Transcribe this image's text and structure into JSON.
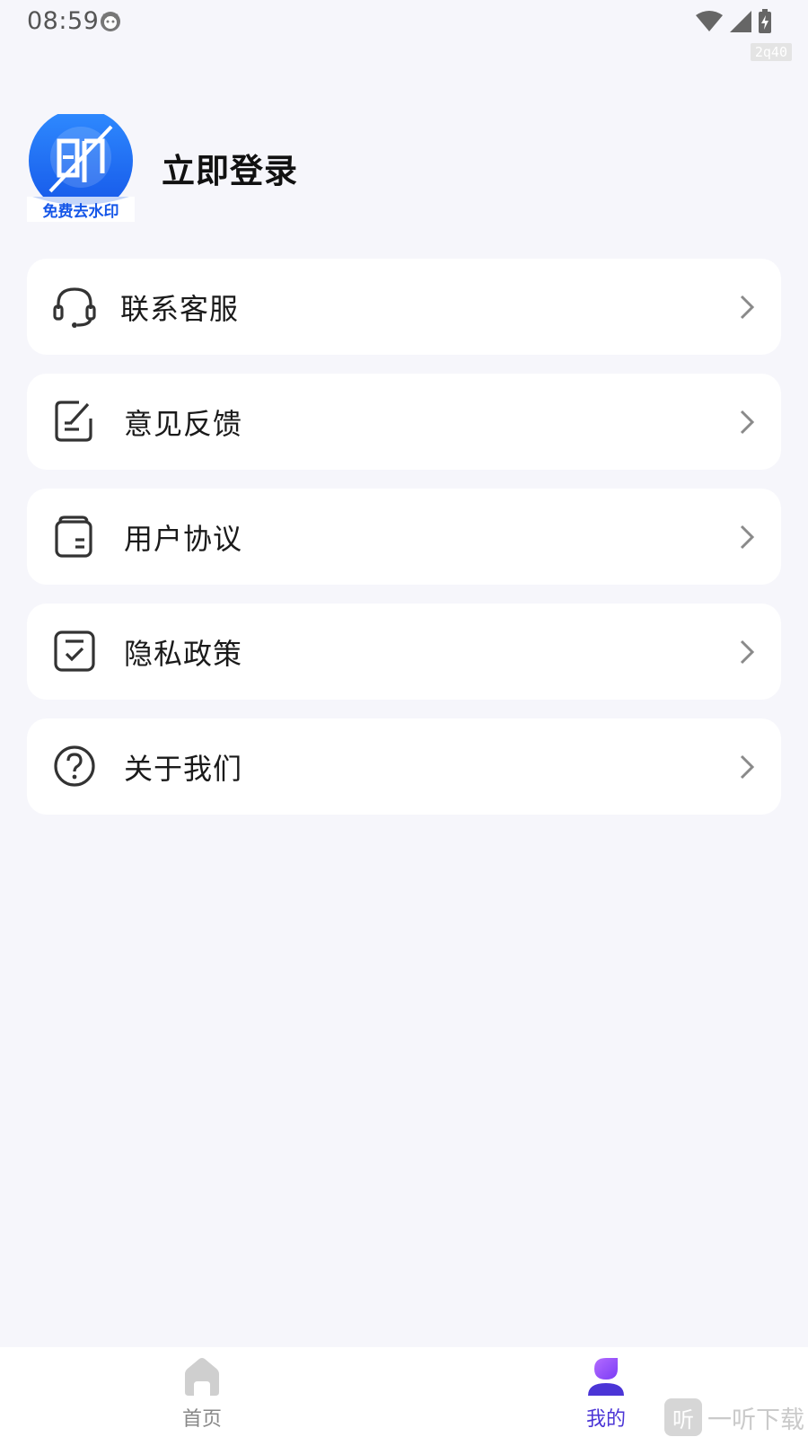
{
  "status_bar": {
    "time": "08:59",
    "debug_badge": "2q40"
  },
  "profile": {
    "avatar_caption": "免费去水印",
    "avatar_glyph": "印",
    "login_label": "立即登录"
  },
  "menu": {
    "items": [
      {
        "label": "联系客服",
        "icon": "headset-icon"
      },
      {
        "label": "意见反馈",
        "icon": "edit-note-icon"
      },
      {
        "label": "用户协议",
        "icon": "document-icon"
      },
      {
        "label": "隐私政策",
        "icon": "checklist-icon"
      },
      {
        "label": "关于我们",
        "icon": "help-circle-icon"
      }
    ]
  },
  "bottom_nav": {
    "home_label": "首页",
    "mine_label": "我的",
    "active_color": "#4b35d6"
  },
  "watermark": {
    "logo": "听",
    "text": "一听下载"
  }
}
